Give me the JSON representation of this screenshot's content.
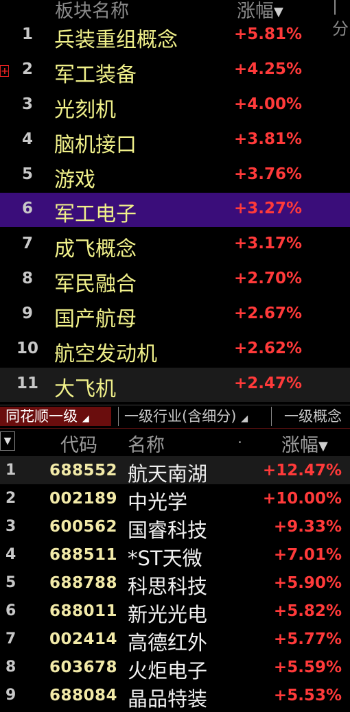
{
  "sector_list": {
    "header": {
      "name_col": "板块名称",
      "change_col": "涨幅",
      "sort_icon": "sort-desc-icon",
      "extra_col": "|分"
    },
    "rows": [
      {
        "rank": "1",
        "name": "兵装重组概念",
        "change": "+5.81%"
      },
      {
        "rank": "2",
        "name": "军工装备",
        "change": "+4.25%"
      },
      {
        "rank": "3",
        "name": "光刻机",
        "change": "+4.00%"
      },
      {
        "rank": "4",
        "name": "脑机接口",
        "change": "+3.81%"
      },
      {
        "rank": "5",
        "name": "游戏",
        "change": "+3.76%"
      },
      {
        "rank": "6",
        "name": "军工电子",
        "change": "+3.27%"
      },
      {
        "rank": "7",
        "name": "成飞概念",
        "change": "+3.17%"
      },
      {
        "rank": "8",
        "name": "军民融合",
        "change": "+2.70%"
      },
      {
        "rank": "9",
        "name": "国产航母",
        "change": "+2.67%"
      },
      {
        "rank": "10",
        "name": "航空发动机",
        "change": "+2.62%"
      },
      {
        "rank": "11",
        "name": "大飞机",
        "change": "+2.47%"
      }
    ]
  },
  "tabs": [
    {
      "label": "同花顺一级"
    },
    {
      "label": "一级行业(含细分)"
    },
    {
      "label": "一级概念"
    }
  ],
  "stock_table": {
    "columns": {
      "code": "代码",
      "name": "名称",
      "dot": ".",
      "change": "涨幅"
    },
    "rows": [
      {
        "rank": "1",
        "code": "688552",
        "name": "航天南湖",
        "change": "+12.47%"
      },
      {
        "rank": "2",
        "code": "002189",
        "name": "中光学",
        "change": "+10.00%"
      },
      {
        "rank": "3",
        "code": "600562",
        "name": "国睿科技",
        "change": "+9.33%"
      },
      {
        "rank": "4",
        "code": "688511",
        "name": "*ST天微",
        "change": "+7.01%"
      },
      {
        "rank": "5",
        "code": "688788",
        "name": "科思科技",
        "change": "+5.90%"
      },
      {
        "rank": "6",
        "code": "688011",
        "name": "新光光电",
        "change": "+5.82%"
      },
      {
        "rank": "7",
        "code": "002414",
        "name": "高德红外",
        "change": "+5.77%"
      },
      {
        "rank": "8",
        "code": "603678",
        "name": "火炬电子",
        "change": "+5.59%"
      },
      {
        "rank": "9",
        "code": "688084",
        "name": "晶品特装",
        "change": "+5.53%"
      }
    ]
  },
  "colors": {
    "up": "#ff3a3a",
    "sector_name": "#f0f08a",
    "selected_row": "#3a0d7a",
    "active_tab": "#6a0d0d"
  }
}
